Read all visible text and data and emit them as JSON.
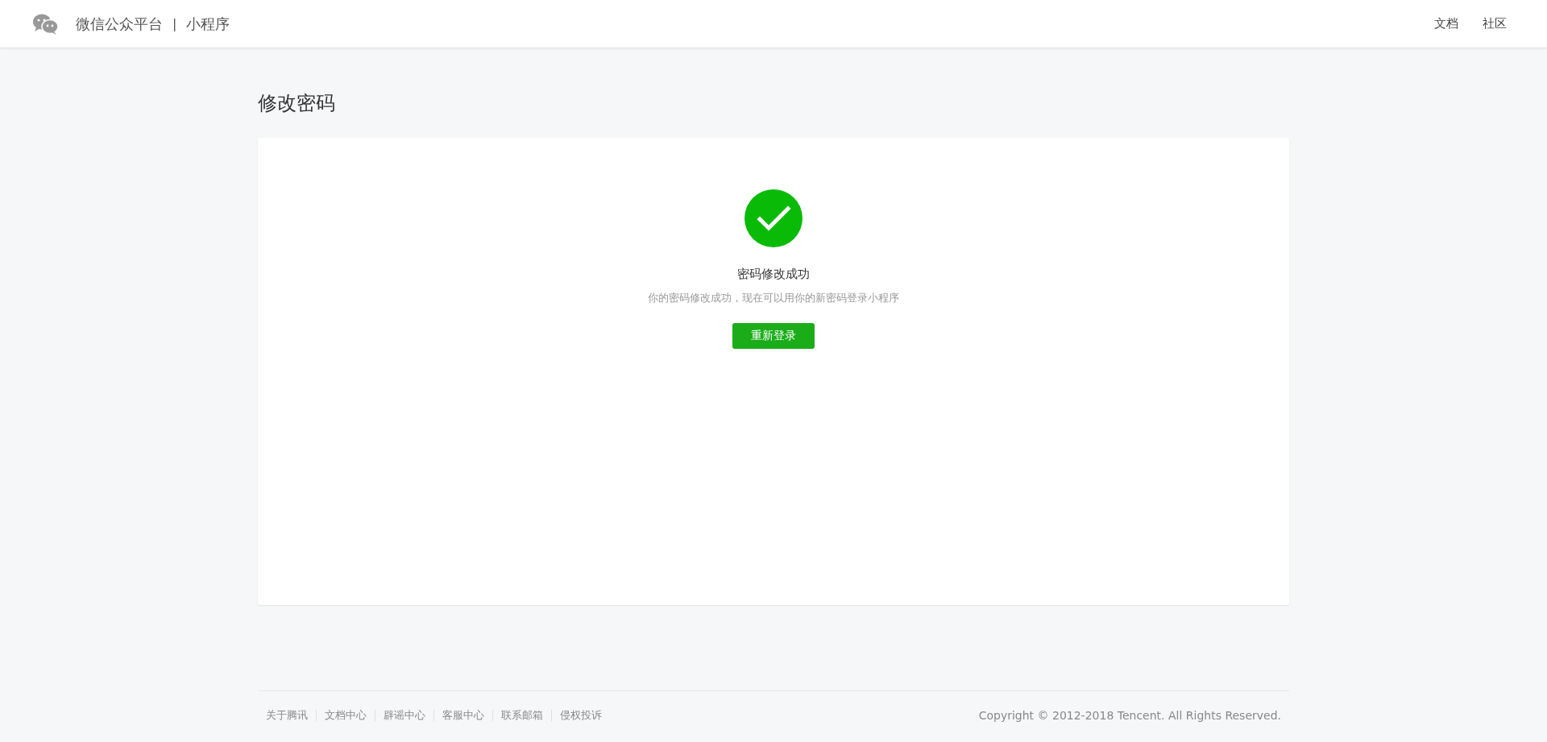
{
  "header": {
    "brand": "微信公众平台",
    "separator": "|",
    "product": "小程序",
    "links": [
      "文档",
      "社区"
    ]
  },
  "page": {
    "title": "修改密码"
  },
  "result": {
    "title": "密码修改成功",
    "description": "你的密码修改成功，现在可以用你的新密码登录小程序",
    "button": "重新登录"
  },
  "footer": {
    "links": [
      "关于腾讯",
      "文档中心",
      "辟谣中心",
      "客服中心",
      "联系邮箱",
      "侵权投诉"
    ],
    "copyright": "Copyright © 2012-2018 Tencent. All Rights Reserved."
  }
}
